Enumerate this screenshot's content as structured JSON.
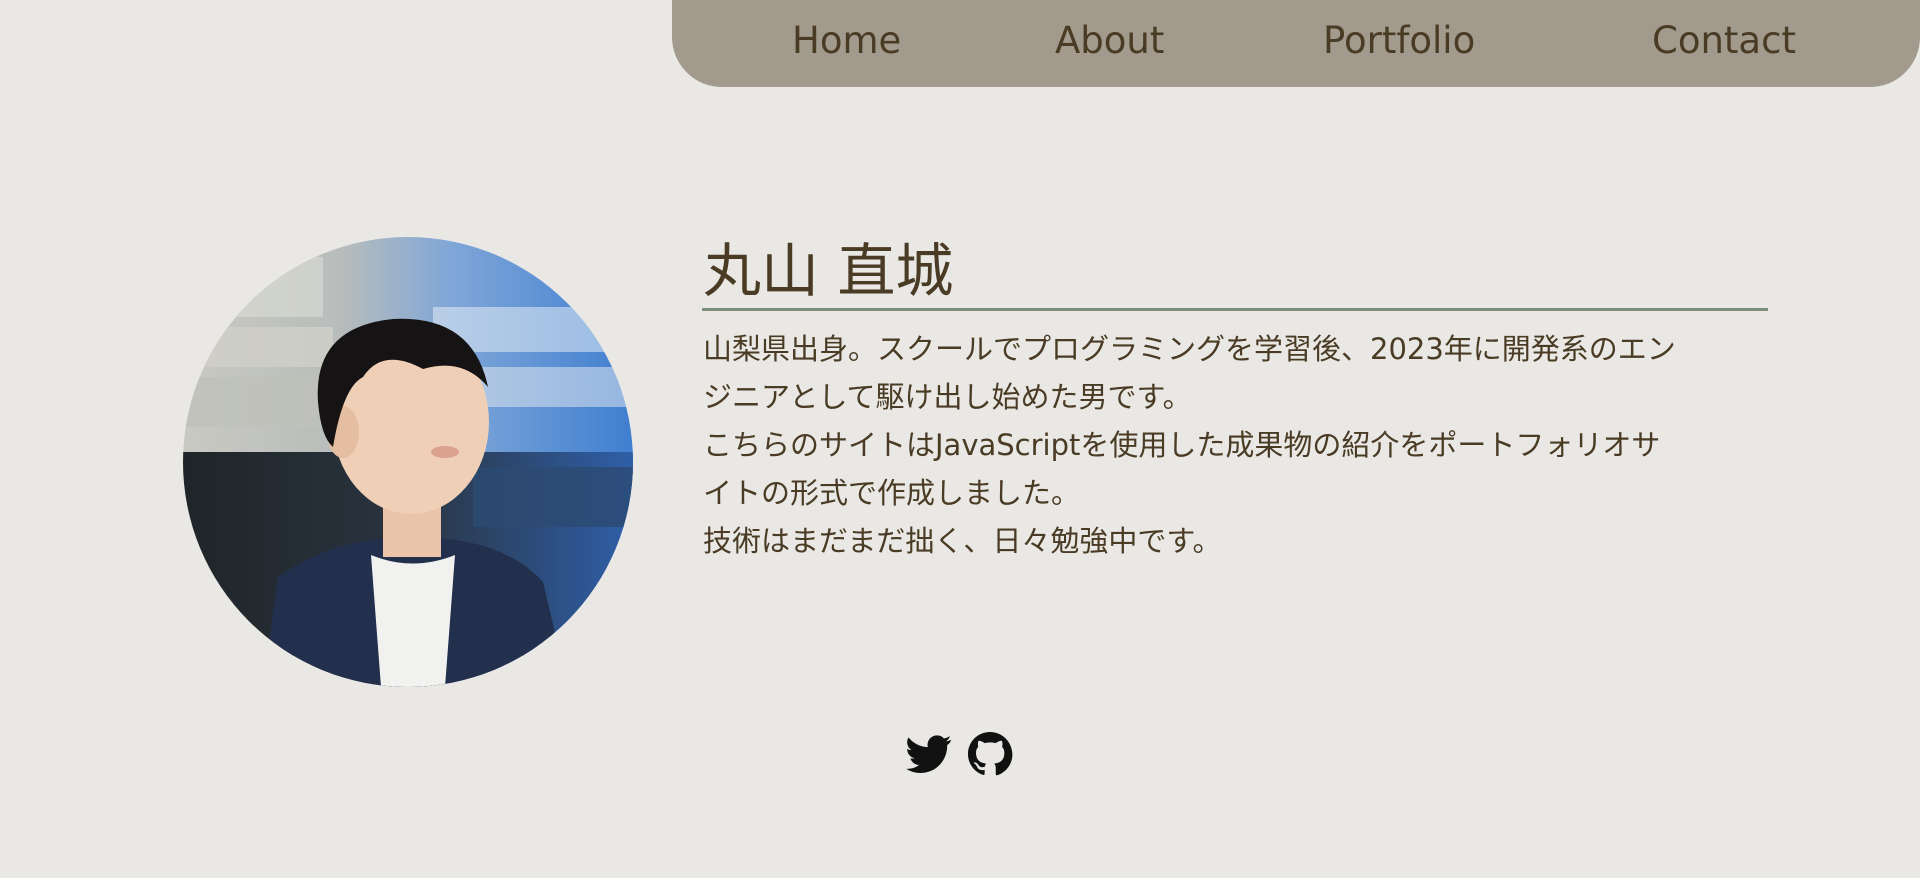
{
  "nav": {
    "items": [
      {
        "label": "Home"
      },
      {
        "label": "About"
      },
      {
        "label": "Portfolio"
      },
      {
        "label": "Contact"
      }
    ]
  },
  "profile": {
    "name": "丸山 直城",
    "photo": "profile-photo",
    "bio_lines": [
      "山梨県出身。スクールでプログラミングを学習後、2023年に開発系のエン",
      "ジニアとして駆け出し始めた男です。",
      "こちらのサイトはJavaScriptを使用した成果物の紹介をポートフォリオサ",
      "イトの形式で作成しました。",
      "技術はまだまだ拙く、日々勉強中です。"
    ]
  },
  "social": {
    "icons": [
      "twitter-icon",
      "github-icon"
    ]
  },
  "colors": {
    "background": "#e9e8e5",
    "nav_background": "#a19a8d",
    "text": "#4a3b24",
    "accent_rule": "#7d8f78",
    "icon": "#111111"
  }
}
